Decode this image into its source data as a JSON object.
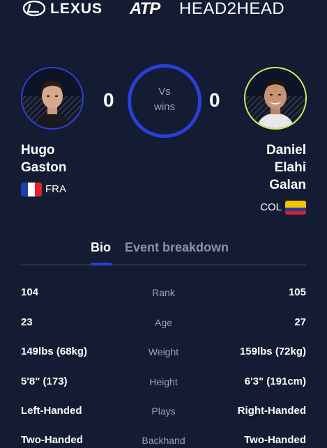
{
  "header": {
    "brand": "LEXUS",
    "tour": "ATP",
    "title": "HEAD2HEAD"
  },
  "player_left": {
    "first": "Hugo",
    "last": "Gaston",
    "country": "FRA",
    "wins": "0",
    "ring_color": "#2f3fd8"
  },
  "player_right": {
    "first": "Daniel",
    "middle": "Elahi",
    "last": "Galan",
    "country": "COL",
    "wins": "0",
    "ring_color": "#d9ec62"
  },
  "versus": {
    "vs": "Vs",
    "wins": "wins"
  },
  "tabs": [
    {
      "label": "Bio",
      "active": true
    },
    {
      "label": "Event breakdown",
      "active": false
    }
  ],
  "stats": [
    {
      "label": "Rank",
      "left": "104",
      "right": "105"
    },
    {
      "label": "Age",
      "left": "23",
      "right": "27"
    },
    {
      "label": "Weight",
      "left": "149lbs (68kg)",
      "right": "159lbs (72kg)"
    },
    {
      "label": "Height",
      "left": "5'8\" (173)",
      "right": "6'3\" (191cm)"
    },
    {
      "label": "Plays",
      "left": "Left-Handed",
      "right": "Right-Handed"
    },
    {
      "label": "Backhand",
      "left": "Two-Handed",
      "right": "Two-Handed"
    }
  ],
  "colors": {
    "background": "#141c33",
    "accent": "#2a3fd8",
    "muted": "#9aa2b6"
  }
}
